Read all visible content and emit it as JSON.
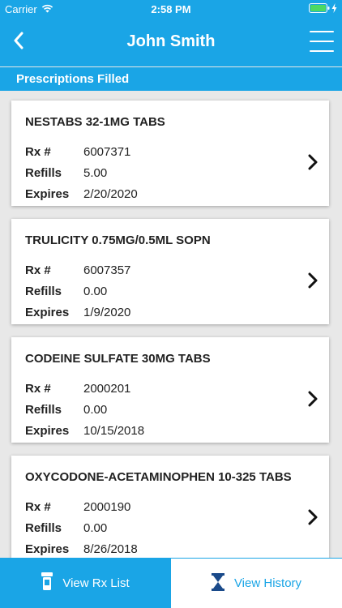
{
  "status": {
    "carrier": "Carrier",
    "time": "2:58 PM"
  },
  "header": {
    "title": "John Smith"
  },
  "section": {
    "title": "Prescriptions Filled"
  },
  "labels": {
    "rx": "Rx #",
    "refills": "Refills",
    "expires": "Expires"
  },
  "prescriptions": [
    {
      "name": "NESTABS 32-1MG TABS",
      "rx": "6007371",
      "refills": "5.00",
      "expires": "2/20/2020"
    },
    {
      "name": "TRULICITY 0.75MG/0.5ML SOPN",
      "rx": "6007357",
      "refills": "0.00",
      "expires": "1/9/2020"
    },
    {
      "name": "CODEINE SULFATE 30MG TABS",
      "rx": "2000201",
      "refills": "0.00",
      "expires": "10/15/2018"
    },
    {
      "name": "OXYCODONE-ACETAMINOPHEN 10-325 TABS",
      "rx": "2000190",
      "refills": "0.00",
      "expires": "8/26/2018"
    }
  ],
  "tabs": {
    "rx_list": "View Rx List",
    "history": "View History"
  },
  "colors": {
    "accent": "#1aa5e6",
    "background": "#e8e8e8"
  }
}
